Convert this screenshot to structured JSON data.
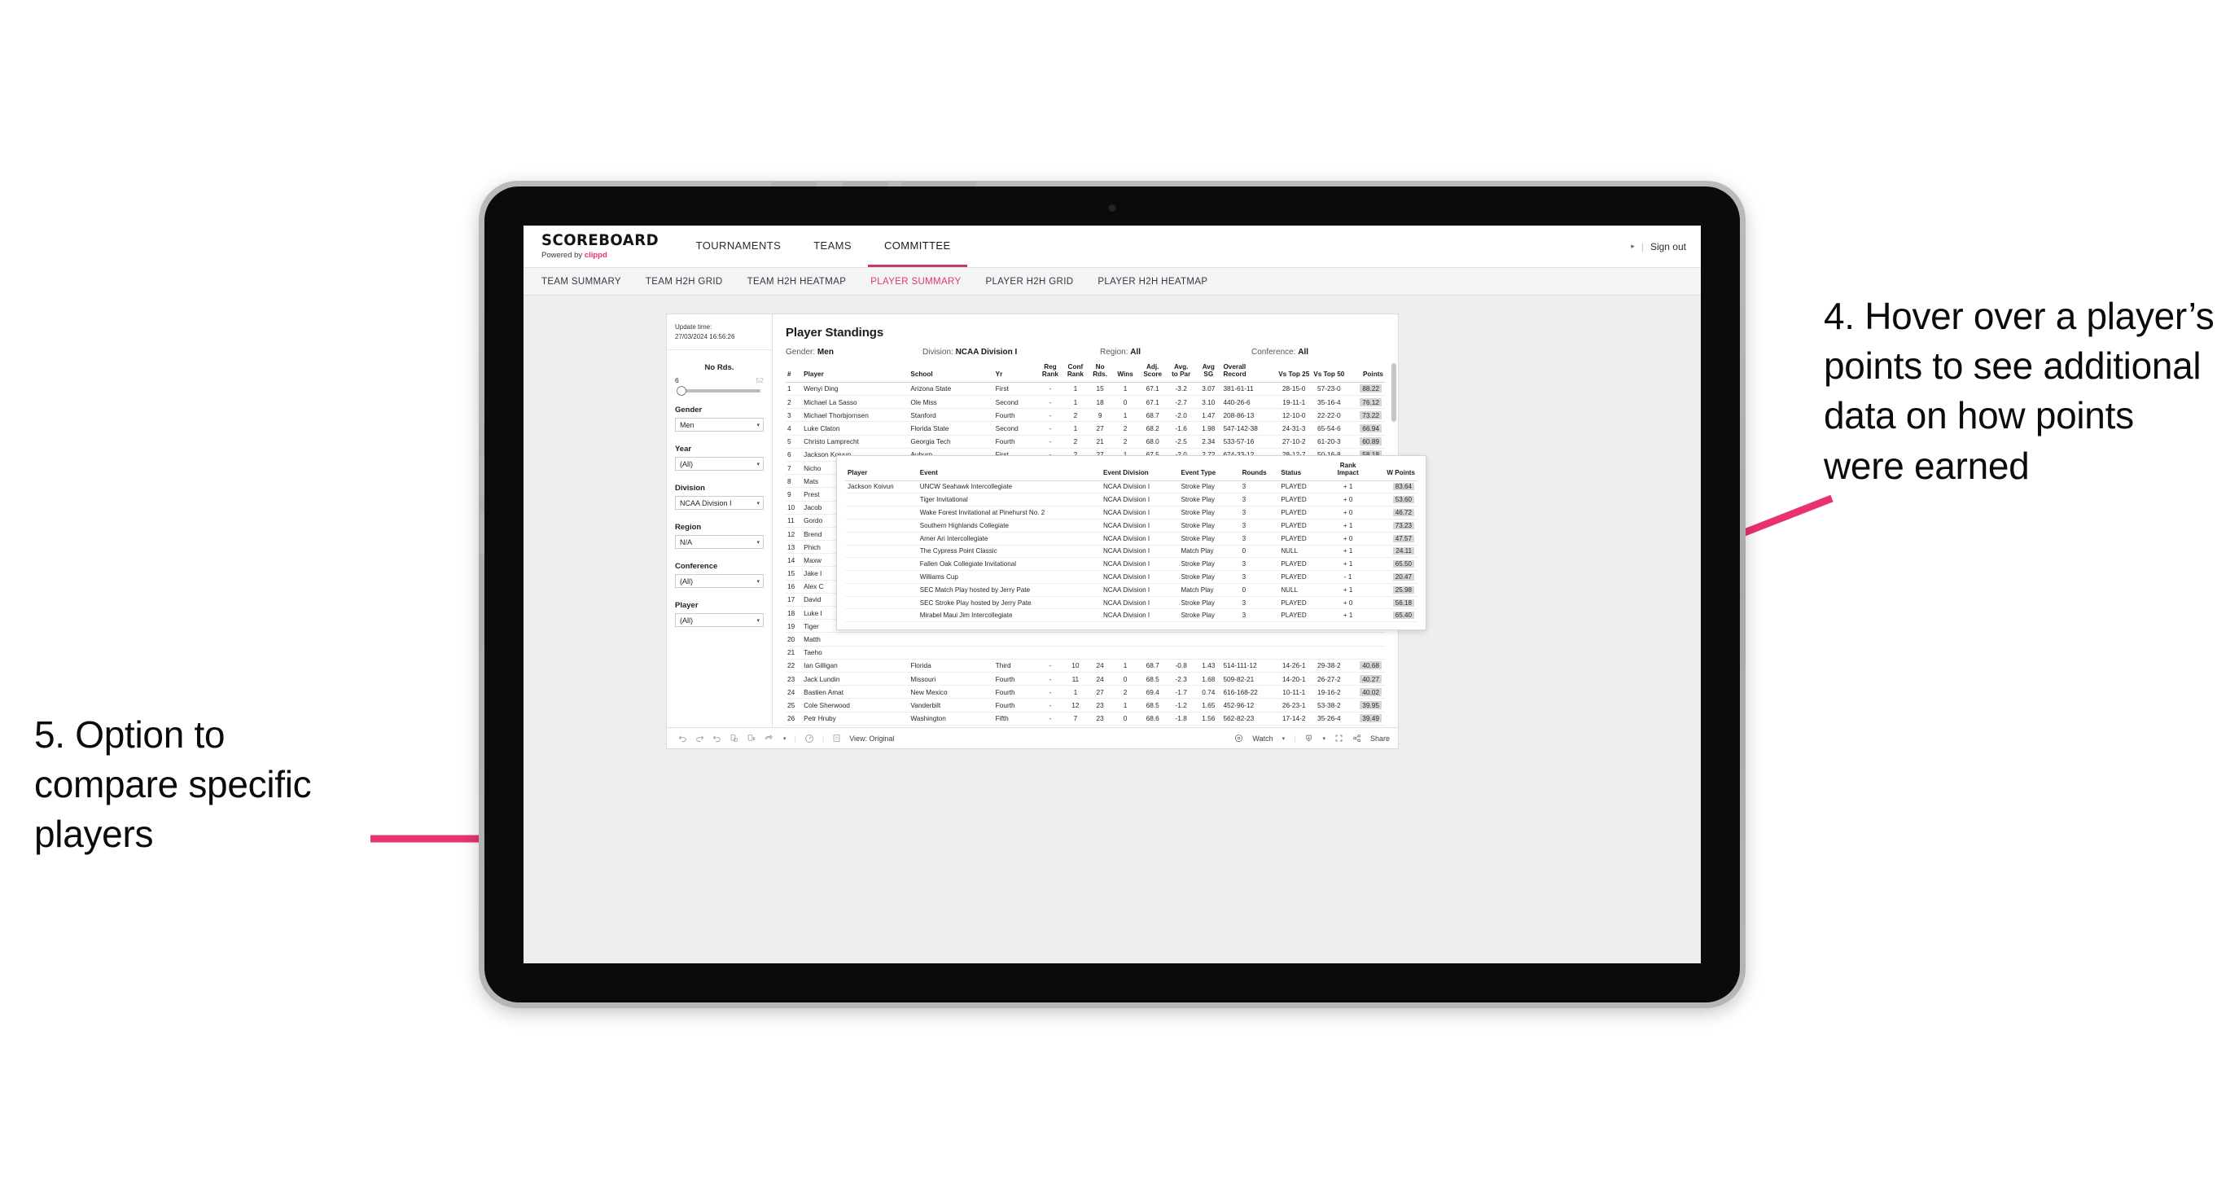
{
  "annotations": {
    "right": "4. Hover over a player’s points to see additional data on how points were earned",
    "left": "5. Option to compare specific players",
    "arrow_color": "#e8336d"
  },
  "app": {
    "brand_name": "SCOREBOARD",
    "brand_powered_prefix": "Powered by ",
    "brand_powered_name": "clippd",
    "main_nav": [
      {
        "label": "TOURNAMENTS",
        "active": false
      },
      {
        "label": "TEAMS",
        "active": false
      },
      {
        "label": "COMMITTEE",
        "active": true
      }
    ],
    "header_right": {
      "caret": "▸",
      "separator": "|",
      "sign_out": "Sign out"
    },
    "sub_nav": [
      {
        "label": "TEAM SUMMARY",
        "active": false
      },
      {
        "label": "TEAM H2H GRID",
        "active": false
      },
      {
        "label": "TEAM H2H HEATMAP",
        "active": false
      },
      {
        "label": "PLAYER SUMMARY",
        "active": true
      },
      {
        "label": "PLAYER H2H GRID",
        "active": false
      },
      {
        "label": "PLAYER H2H HEATMAP",
        "active": false
      }
    ]
  },
  "filters": {
    "update_time_label": "Update time:",
    "update_time_value": "27/03/2024 16:56:26",
    "no_rounds": {
      "title": "No Rds.",
      "min": "6",
      "max": "52"
    },
    "groups": [
      {
        "label": "Gender",
        "value": "Men"
      },
      {
        "label": "Year",
        "value": "(All)"
      },
      {
        "label": "Division",
        "value": "NCAA Division I"
      },
      {
        "label": "Region",
        "value": "N/A"
      },
      {
        "label": "Conference",
        "value": "(All)"
      },
      {
        "label": "Player",
        "value": "(All)"
      }
    ],
    "caret": "▾"
  },
  "report": {
    "title": "Player Standings",
    "meta": [
      {
        "label": "Gender: ",
        "value": "Men"
      },
      {
        "label": "Division: ",
        "value": "NCAA Division I"
      },
      {
        "label": "Region: ",
        "value": "All"
      },
      {
        "label": "Conference: ",
        "value": "All"
      }
    ],
    "columns": [
      "#",
      "Player",
      "School",
      "Yr",
      "Reg Rank",
      "Conf Rank",
      "No Rds.",
      "Wins",
      "Adj. Score",
      "Avg. to Par",
      "Avg SG",
      "Overall Record",
      "Vs Top 25",
      "Vs Top 50",
      "Points"
    ],
    "columns_split": [
      {
        "l1": "#",
        "l2": ""
      },
      {
        "l1": "Player",
        "l2": ""
      },
      {
        "l1": "School",
        "l2": ""
      },
      {
        "l1": "Yr",
        "l2": ""
      },
      {
        "l1": "Reg",
        "l2": "Rank"
      },
      {
        "l1": "Conf",
        "l2": "Rank"
      },
      {
        "l1": "No",
        "l2": "Rds."
      },
      {
        "l1": "Wins",
        "l2": ""
      },
      {
        "l1": "Adj.",
        "l2": "Score"
      },
      {
        "l1": "Avg.",
        "l2": "to Par"
      },
      {
        "l1": "Avg",
        "l2": "SG"
      },
      {
        "l1": "Overall",
        "l2": "Record"
      },
      {
        "l1": "Vs Top 25",
        "l2": ""
      },
      {
        "l1": "Vs Top 50",
        "l2": ""
      },
      {
        "l1": "Points",
        "l2": ""
      }
    ],
    "rows": [
      {
        "num": "1",
        "player": "Wenyi Ding",
        "school": "Arizona State",
        "yr": "First",
        "reg": "-",
        "conf": "1",
        "nords": "15",
        "wins": "1",
        "adj": "67.1",
        "topar": "-3.2",
        "sg": "3.07",
        "record": "381-61-11",
        "t25": "28-15-0",
        "t50": "57-23-0",
        "points": "88.22"
      },
      {
        "num": "2",
        "player": "Michael La Sasso",
        "school": "Ole Miss",
        "yr": "Second",
        "reg": "-",
        "conf": "1",
        "nords": "18",
        "wins": "0",
        "adj": "67.1",
        "topar": "-2.7",
        "sg": "3.10",
        "record": "440-26-6",
        "t25": "19-11-1",
        "t50": "35-16-4",
        "points": "76.12"
      },
      {
        "num": "3",
        "player": "Michael Thorbjornsen",
        "school": "Stanford",
        "yr": "Fourth",
        "reg": "-",
        "conf": "2",
        "nords": "9",
        "wins": "1",
        "adj": "68.7",
        "topar": "-2.0",
        "sg": "1.47",
        "record": "208-86-13",
        "t25": "12-10-0",
        "t50": "22-22-0",
        "points": "73.22"
      },
      {
        "num": "4",
        "player": "Luke Claton",
        "school": "Florida State",
        "yr": "Second",
        "reg": "-",
        "conf": "1",
        "nords": "27",
        "wins": "2",
        "adj": "68.2",
        "topar": "-1.6",
        "sg": "1.98",
        "record": "547-142-38",
        "t25": "24-31-3",
        "t50": "65-54-6",
        "points": "66.94"
      },
      {
        "num": "5",
        "player": "Christo Lamprecht",
        "school": "Georgia Tech",
        "yr": "Fourth",
        "reg": "-",
        "conf": "2",
        "nords": "21",
        "wins": "2",
        "adj": "68.0",
        "topar": "-2.5",
        "sg": "2.34",
        "record": "533-57-16",
        "t25": "27-10-2",
        "t50": "61-20-3",
        "points": "60.89"
      },
      {
        "num": "6",
        "player": "Jackson Koivun",
        "school": "Auburn",
        "yr": "First",
        "reg": "-",
        "conf": "2",
        "nords": "27",
        "wins": "1",
        "adj": "67.5",
        "topar": "-2.0",
        "sg": "2.72",
        "record": "674-33-12",
        "t25": "28-12-7",
        "t50": "50-16-8",
        "points": "58.18",
        "highlight": true
      },
      {
        "num": "7",
        "player": "Nicho",
        "school": "",
        "yr": "",
        "reg": "",
        "conf": "",
        "nords": "",
        "wins": "",
        "adj": "",
        "topar": "",
        "sg": "",
        "record": "",
        "t25": "",
        "t50": "",
        "points": ""
      },
      {
        "num": "8",
        "player": "Mats",
        "school": "",
        "yr": "",
        "reg": "",
        "conf": "",
        "nords": "",
        "wins": "",
        "adj": "",
        "topar": "",
        "sg": "",
        "record": "",
        "t25": "",
        "t50": "",
        "points": ""
      },
      {
        "num": "9",
        "player": "Prest",
        "school": "",
        "yr": "",
        "reg": "",
        "conf": "",
        "nords": "",
        "wins": "",
        "adj": "",
        "topar": "",
        "sg": "",
        "record": "",
        "t25": "",
        "t50": "",
        "points": ""
      },
      {
        "num": "10",
        "player": "Jacob",
        "school": "",
        "yr": "",
        "reg": "",
        "conf": "",
        "nords": "",
        "wins": "",
        "adj": "",
        "topar": "",
        "sg": "",
        "record": "",
        "t25": "",
        "t50": "",
        "points": ""
      },
      {
        "num": "11",
        "player": "Gordo",
        "school": "",
        "yr": "",
        "reg": "",
        "conf": "",
        "nords": "",
        "wins": "",
        "adj": "",
        "topar": "",
        "sg": "",
        "record": "",
        "t25": "",
        "t50": "",
        "points": ""
      },
      {
        "num": "12",
        "player": "Brend",
        "school": "",
        "yr": "",
        "reg": "",
        "conf": "",
        "nords": "",
        "wins": "",
        "adj": "",
        "topar": "",
        "sg": "",
        "record": "",
        "t25": "",
        "t50": "",
        "points": ""
      },
      {
        "num": "13",
        "player": "Phich",
        "school": "",
        "yr": "",
        "reg": "",
        "conf": "",
        "nords": "",
        "wins": "",
        "adj": "",
        "topar": "",
        "sg": "",
        "record": "",
        "t25": "",
        "t50": "",
        "points": ""
      },
      {
        "num": "14",
        "player": "Maxw",
        "school": "",
        "yr": "",
        "reg": "",
        "conf": "",
        "nords": "",
        "wins": "",
        "adj": "",
        "topar": "",
        "sg": "",
        "record": "",
        "t25": "",
        "t50": "",
        "points": ""
      },
      {
        "num": "15",
        "player": "Jake I",
        "school": "",
        "yr": "",
        "reg": "",
        "conf": "",
        "nords": "",
        "wins": "",
        "adj": "",
        "topar": "",
        "sg": "",
        "record": "",
        "t25": "",
        "t50": "",
        "points": ""
      },
      {
        "num": "16",
        "player": "Alex C",
        "school": "",
        "yr": "",
        "reg": "",
        "conf": "",
        "nords": "",
        "wins": "",
        "adj": "",
        "topar": "",
        "sg": "",
        "record": "",
        "t25": "",
        "t50": "",
        "points": ""
      },
      {
        "num": "17",
        "player": "David",
        "school": "",
        "yr": "",
        "reg": "",
        "conf": "",
        "nords": "",
        "wins": "",
        "adj": "",
        "topar": "",
        "sg": "",
        "record": "",
        "t25": "",
        "t50": "",
        "points": ""
      },
      {
        "num": "18",
        "player": "Luke I",
        "school": "",
        "yr": "",
        "reg": "",
        "conf": "",
        "nords": "",
        "wins": "",
        "adj": "",
        "topar": "",
        "sg": "",
        "record": "",
        "t25": "",
        "t50": "",
        "points": ""
      },
      {
        "num": "19",
        "player": "Tiger",
        "school": "",
        "yr": "",
        "reg": "",
        "conf": "",
        "nords": "",
        "wins": "",
        "adj": "",
        "topar": "",
        "sg": "",
        "record": "",
        "t25": "",
        "t50": "",
        "points": ""
      },
      {
        "num": "20",
        "player": "Matth",
        "school": "",
        "yr": "",
        "reg": "",
        "conf": "",
        "nords": "",
        "wins": "",
        "adj": "",
        "topar": "",
        "sg": "",
        "record": "",
        "t25": "",
        "t50": "",
        "points": ""
      },
      {
        "num": "21",
        "player": "Taeho",
        "school": "",
        "yr": "",
        "reg": "",
        "conf": "",
        "nords": "",
        "wins": "",
        "adj": "",
        "topar": "",
        "sg": "",
        "record": "",
        "t25": "",
        "t50": "",
        "points": ""
      },
      {
        "num": "22",
        "player": "Ian Gilligan",
        "school": "Florida",
        "yr": "Third",
        "reg": "-",
        "conf": "10",
        "nords": "24",
        "wins": "1",
        "adj": "68.7",
        "topar": "-0.8",
        "sg": "1.43",
        "record": "514-111-12",
        "t25": "14-26-1",
        "t50": "29-38-2",
        "points": "40.68"
      },
      {
        "num": "23",
        "player": "Jack Lundin",
        "school": "Missouri",
        "yr": "Fourth",
        "reg": "-",
        "conf": "11",
        "nords": "24",
        "wins": "0",
        "adj": "68.5",
        "topar": "-2.3",
        "sg": "1.68",
        "record": "509-82-21",
        "t25": "14-20-1",
        "t50": "26-27-2",
        "points": "40.27"
      },
      {
        "num": "24",
        "player": "Bastien Amat",
        "school": "New Mexico",
        "yr": "Fourth",
        "reg": "-",
        "conf": "1",
        "nords": "27",
        "wins": "2",
        "adj": "69.4",
        "topar": "-1.7",
        "sg": "0.74",
        "record": "616-168-22",
        "t25": "10-11-1",
        "t50": "19-16-2",
        "points": "40.02"
      },
      {
        "num": "25",
        "player": "Cole Sherwood",
        "school": "Vanderbilt",
        "yr": "Fourth",
        "reg": "-",
        "conf": "12",
        "nords": "23",
        "wins": "1",
        "adj": "68.5",
        "topar": "-1.2",
        "sg": "1.65",
        "record": "452-96-12",
        "t25": "26-23-1",
        "t50": "53-38-2",
        "points": "39.95"
      },
      {
        "num": "26",
        "player": "Petr Hruby",
        "school": "Washington",
        "yr": "Fifth",
        "reg": "-",
        "conf": "7",
        "nords": "23",
        "wins": "0",
        "adj": "68.6",
        "topar": "-1.8",
        "sg": "1.56",
        "record": "562-82-23",
        "t25": "17-14-2",
        "t50": "35-26-4",
        "points": "39.49"
      }
    ]
  },
  "tooltip": {
    "columns_split": [
      {
        "l1": "Player",
        "l2": ""
      },
      {
        "l1": "Event",
        "l2": ""
      },
      {
        "l1": "Event Division",
        "l2": ""
      },
      {
        "l1": "Event Type",
        "l2": ""
      },
      {
        "l1": "Rounds",
        "l2": ""
      },
      {
        "l1": "Status",
        "l2": ""
      },
      {
        "l1": "Rank",
        "l2": "Impact"
      },
      {
        "l1": "W Points",
        "l2": ""
      }
    ],
    "player": "Jackson Koivun",
    "rows": [
      {
        "event": "UNCW Seahawk Intercollegiate",
        "division": "NCAA Division I",
        "type": "Stroke Play",
        "rounds": "3",
        "status": "PLAYED",
        "impact": "+ 1",
        "wpoints": "83.64"
      },
      {
        "event": "Tiger Invitational",
        "division": "NCAA Division I",
        "type": "Stroke Play",
        "rounds": "3",
        "status": "PLAYED",
        "impact": "+ 0",
        "wpoints": "53.60"
      },
      {
        "event": "Wake Forest Invitational at Pinehurst No. 2",
        "division": "NCAA Division I",
        "type": "Stroke Play",
        "rounds": "3",
        "status": "PLAYED",
        "impact": "+ 0",
        "wpoints": "46.72"
      },
      {
        "event": "Southern Highlands Collegiate",
        "division": "NCAA Division I",
        "type": "Stroke Play",
        "rounds": "3",
        "status": "PLAYED",
        "impact": "+ 1",
        "wpoints": "73.23"
      },
      {
        "event": "Amer Ari Intercollegiate",
        "division": "NCAA Division I",
        "type": "Stroke Play",
        "rounds": "3",
        "status": "PLAYED",
        "impact": "+ 0",
        "wpoints": "47.57"
      },
      {
        "event": "The Cypress Point Classic",
        "division": "NCAA Division I",
        "type": "Match Play",
        "rounds": "0",
        "status": "NULL",
        "impact": "+ 1",
        "wpoints": "24.11"
      },
      {
        "event": "Fallen Oak Collegiate Invitational",
        "division": "NCAA Division I",
        "type": "Stroke Play",
        "rounds": "3",
        "status": "PLAYED",
        "impact": "+ 1",
        "wpoints": "65.50"
      },
      {
        "event": "Williams Cup",
        "division": "NCAA Division I",
        "type": "Stroke Play",
        "rounds": "3",
        "status": "PLAYED",
        "impact": "- 1",
        "wpoints": "20.47"
      },
      {
        "event": "SEC Match Play hosted by Jerry Pate",
        "division": "NCAA Division I",
        "type": "Match Play",
        "rounds": "0",
        "status": "NULL",
        "impact": "+ 1",
        "wpoints": "25.98"
      },
      {
        "event": "SEC Stroke Play hosted by Jerry Pate",
        "division": "NCAA Division I",
        "type": "Stroke Play",
        "rounds": "3",
        "status": "PLAYED",
        "impact": "+ 0",
        "wpoints": "56.18"
      },
      {
        "event": "Mirabel Maui Jim Intercollegiate",
        "division": "NCAA Division I",
        "type": "Stroke Play",
        "rounds": "3",
        "status": "PLAYED",
        "impact": "+ 1",
        "wpoints": "65.40"
      }
    ]
  },
  "toolbar": {
    "view_label": "View: Original",
    "watch_label": "Watch",
    "share_label": "Share",
    "caret": "▾"
  }
}
